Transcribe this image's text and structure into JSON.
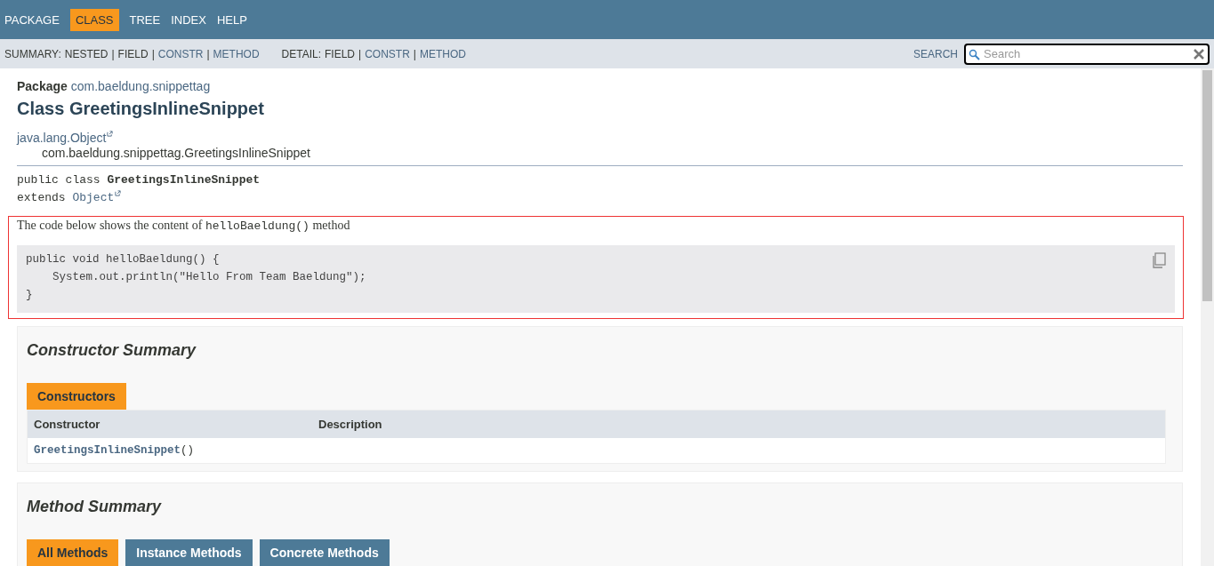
{
  "nav": [
    {
      "label": "PACKAGE",
      "selected": false
    },
    {
      "label": "CLASS",
      "selected": true
    },
    {
      "label": "TREE",
      "selected": false
    },
    {
      "label": "INDEX",
      "selected": false
    },
    {
      "label": "HELP",
      "selected": false
    }
  ],
  "subnav": {
    "summary": {
      "label": "SUMMARY:",
      "items": [
        {
          "label": "NESTED",
          "link": false
        },
        {
          "separator": "|",
          "label": "FIELD",
          "link": false
        },
        {
          "separator": "|",
          "label": "CONSTR",
          "link": true
        },
        {
          "separator": "|",
          "label": "METHOD",
          "link": true
        }
      ]
    },
    "detail": {
      "label": "DETAIL:",
      "items": [
        {
          "label": "FIELD",
          "link": false
        },
        {
          "separator": "|",
          "label": "CONSTR",
          "link": true
        },
        {
          "separator": "|",
          "label": "METHOD",
          "link": true
        }
      ]
    }
  },
  "search": {
    "label": "SEARCH",
    "placeholder": "Search"
  },
  "package": {
    "label": "Package",
    "name": "com.baeldung.snippettag"
  },
  "title": "Class GreetingsInlineSnippet",
  "hierarchy": {
    "parent": "java.lang.Object",
    "child": "com.baeldung.snippettag.GreetingsInlineSnippet"
  },
  "signature": {
    "prefix": "public class",
    "name": "GreetingsInlineSnippet",
    "extends": "extends",
    "parent": "Object"
  },
  "description": {
    "before": "The code below shows the content of",
    "code": "helloBaeldung()",
    "after": "method"
  },
  "snippet": [
    "public void helloBaeldung() {",
    "    System.out.println(\"Hello From Team Baeldung\");",
    "}"
  ],
  "constructor_summary": {
    "title": "Constructor Summary",
    "tabs": [
      {
        "label": "Constructors",
        "selected": true
      }
    ],
    "columns": [
      "Constructor",
      "Description"
    ],
    "rows": [
      {
        "name": "GreetingsInlineSnippet",
        "args": "()"
      }
    ]
  },
  "method_summary": {
    "title": "Method Summary",
    "tabs": [
      {
        "label": "All Methods",
        "selected": true
      },
      {
        "label": "Instance Methods",
        "selected": false
      },
      {
        "label": "Concrete Methods",
        "selected": false
      }
    ]
  }
}
